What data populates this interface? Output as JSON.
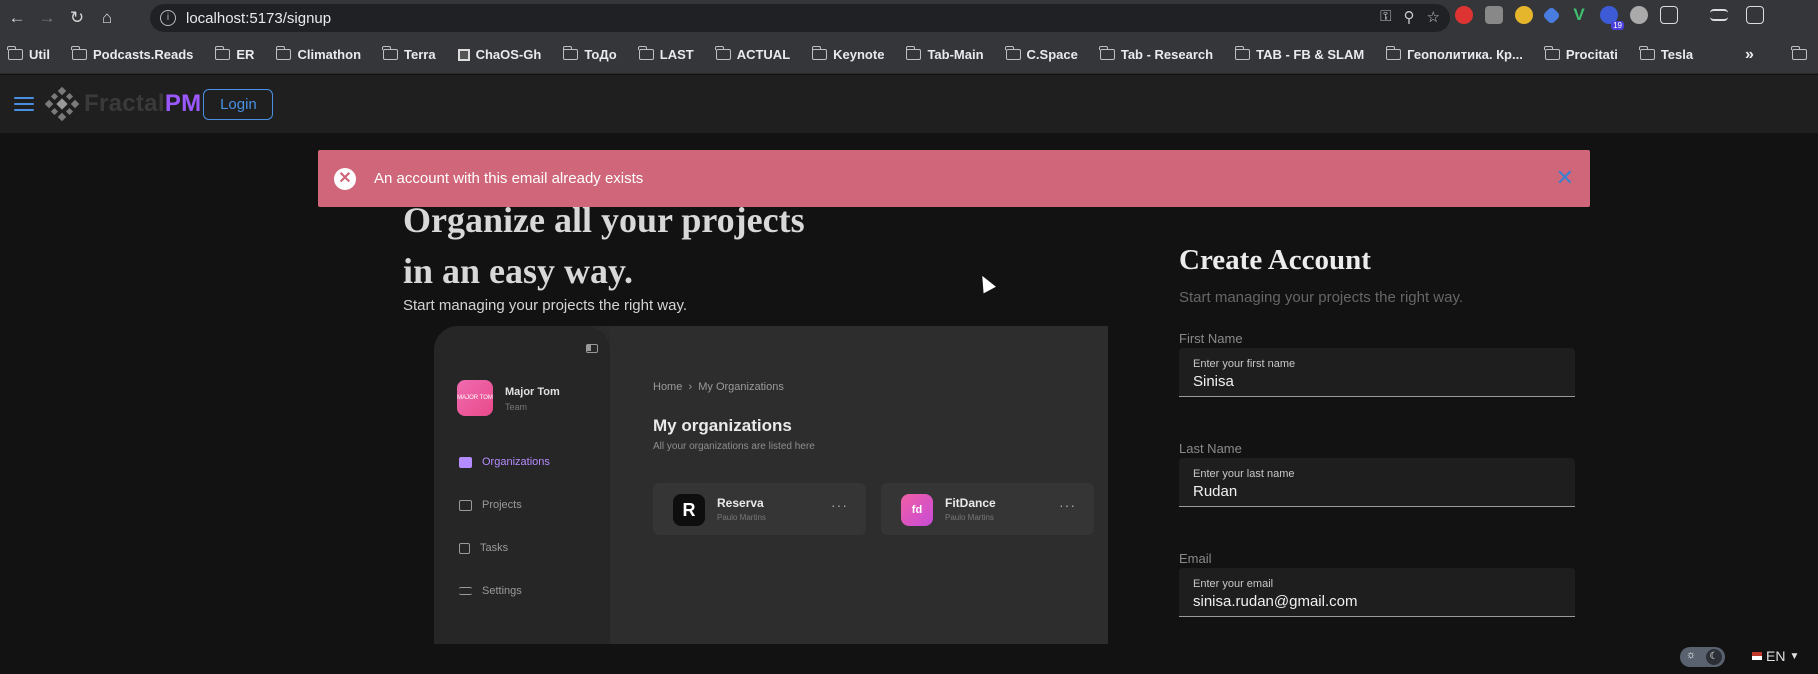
{
  "browser": {
    "url": "localhost:5173/signup",
    "bookmarks": [
      "Util",
      "Podcasts.Reads",
      "ER",
      "Climathon",
      "Terra",
      "ChaOS-Gh",
      "ТоДо",
      "LAST",
      "ACTUAL",
      "Keynote",
      "Tab-Main",
      "C.Space",
      "Tab - Research",
      "TAB - FB & SLAM",
      "Геополитика. Кр...",
      "Procitati",
      "Tesla"
    ],
    "extension_badge": "19"
  },
  "appbar": {
    "logo_text_1": "Fractal",
    "logo_text_2": "PM",
    "login_label": "Login"
  },
  "alert": {
    "message": "An account with this email already exists"
  },
  "hero": {
    "title_line1": "Organize all your projects",
    "title_line2": "in an easy way.",
    "subtitle": "Start managing your projects the right way."
  },
  "preview": {
    "user_name": "Major Tom",
    "user_role": "Team",
    "avatar_text": "MAJOR TOM",
    "nav": [
      "Organizations",
      "Projects",
      "Tasks",
      "Settings"
    ],
    "breadcrumb_home": "Home",
    "breadcrumb_current": "My Organizations",
    "heading": "My organizations",
    "heading_sub": "All your organizations are listed here",
    "cards": [
      {
        "name": "Reserva",
        "owner": "Paulo Martins",
        "logo": "R"
      },
      {
        "name": "FitDance",
        "owner": "Paulo Martins",
        "logo": "fd"
      }
    ]
  },
  "form": {
    "title": "Create Account",
    "subtitle": "Start managing your projects the right way.",
    "fields": [
      {
        "label": "First Name",
        "hint": "Enter your first name",
        "value": "Sinisa"
      },
      {
        "label": "Last Name",
        "hint": "Enter your last name",
        "value": "Rudan"
      },
      {
        "label": "Email",
        "hint": "Enter your email",
        "value": "sinisa.rudan@gmail.com"
      }
    ]
  },
  "footer": {
    "language": "EN"
  },
  "colors": {
    "alert_bg": "#cf6679",
    "accent_blue": "#4a90e2",
    "brand_purple": "#9b59ff"
  }
}
